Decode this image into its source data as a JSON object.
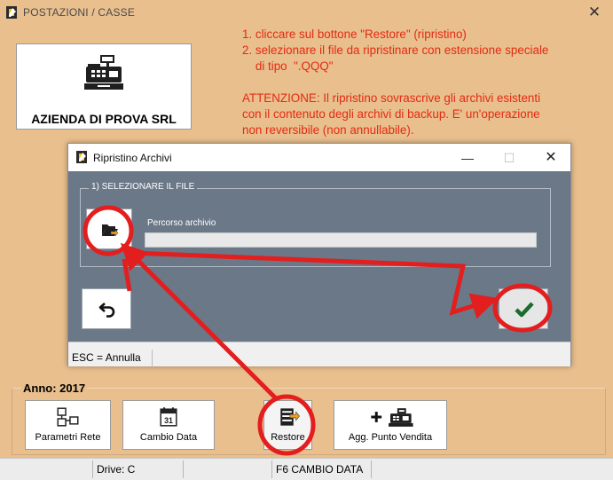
{
  "window": {
    "title": "POSTAZIONI / CASSE",
    "close_glyph": "✕"
  },
  "company": {
    "name": "AZIENDA DI PROVA SRL",
    "icon": "cash-register-icon"
  },
  "instructions": {
    "line1": "1. cliccare sul bottone \"Restore\" (ripristino)",
    "line2": "2. selezionare il file da ripristinare con estensione speciale",
    "line3": "    di tipo  \".QQQ\"",
    "warning1": "ATTENZIONE: Il ripristino sovrascrive gli archivi esistenti",
    "warning2": "con il contenuto degli archivi di backup. E' un'operazione",
    "warning3": "non reversibile (non annullabile).",
    "color": "#e32b13"
  },
  "dialog": {
    "title": "Ripristino Archivi",
    "min_glyph": "—",
    "max_glyph": "☐",
    "close_glyph": "✕",
    "section_label": "1)  SELEZIONARE IL FILE",
    "path_label": "Percorso archivio",
    "path_value": "",
    "status": "ESC = Annulla",
    "body_color": "#6b7888"
  },
  "year": {
    "label": "Anno: 2017"
  },
  "toolbar": {
    "buttons": [
      {
        "label": "Parametri Rete",
        "icon": "network-icon"
      },
      {
        "label": "Cambio Data",
        "icon": "calendar-icon"
      },
      {
        "label": "Restore",
        "icon": "restore-icon"
      },
      {
        "label": "Agg. Punto Vendita",
        "icon": "add-register-icon"
      }
    ],
    "calendar_day": "31"
  },
  "statusbar": {
    "cells": [
      "Drive: C",
      "",
      "F6 CAMBIO DATA",
      ""
    ]
  }
}
